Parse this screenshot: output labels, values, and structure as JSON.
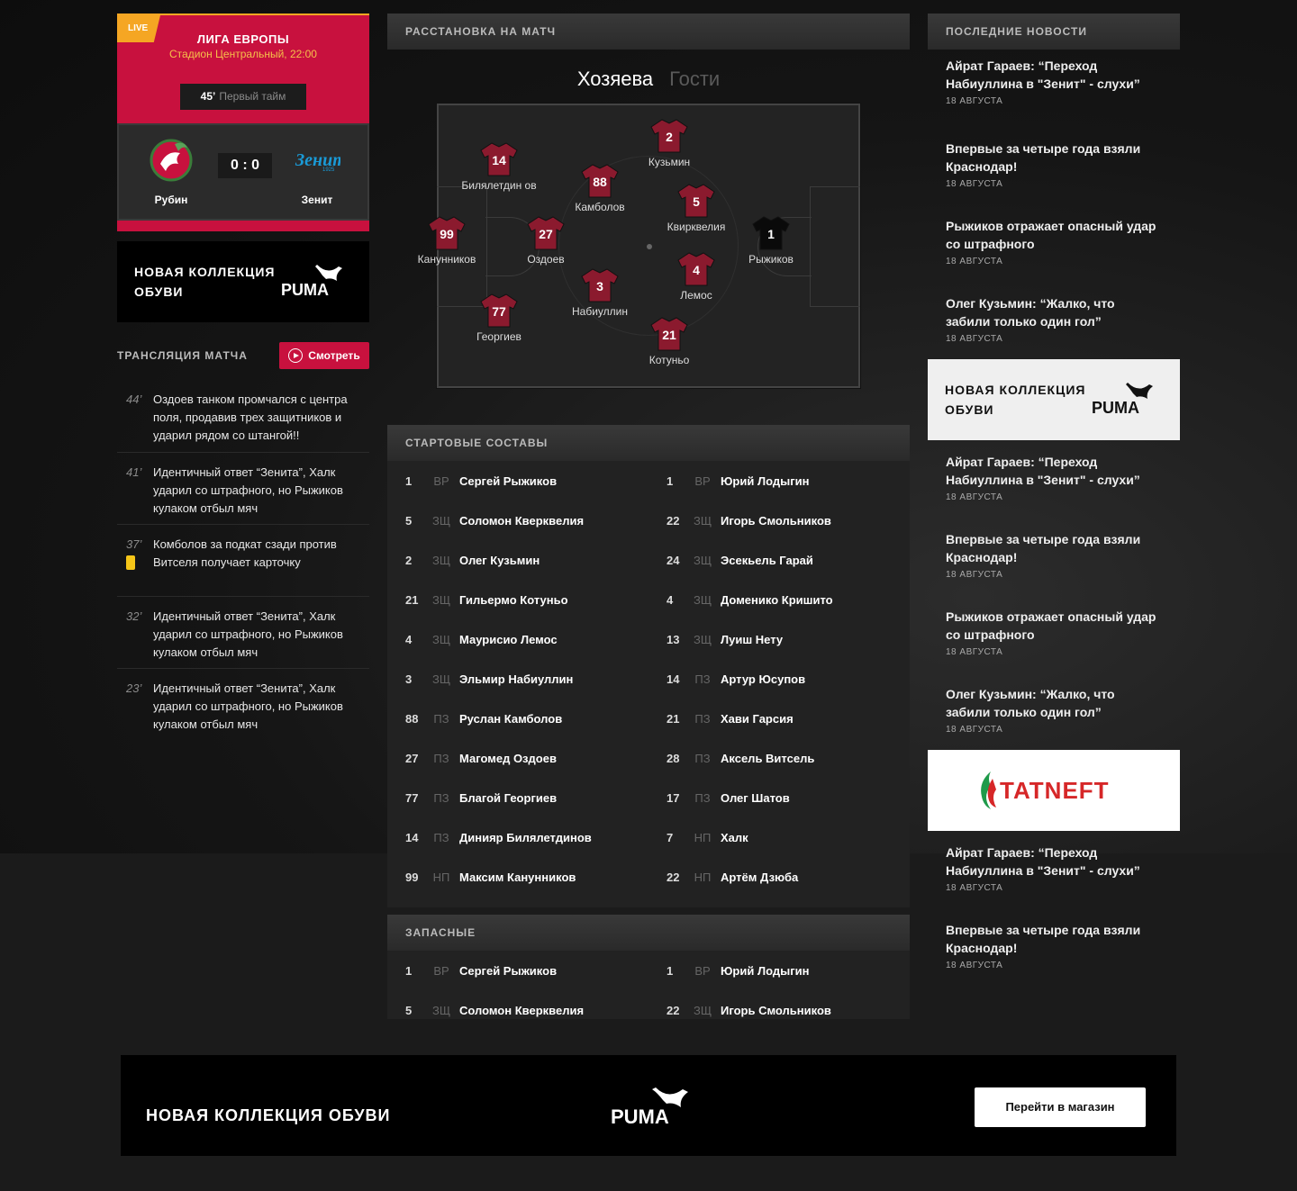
{
  "match": {
    "live_badge": "LIVE",
    "league": "ЛИГА ЕВРОПЫ",
    "stadium": "Стадион Центральный, 22:00",
    "minute": "45’",
    "period": "Первый тайм",
    "home": "Рубин",
    "away": "Зенит",
    "score": "0 : 0"
  },
  "ad": {
    "collection_line1": "НОВАЯ КОЛЛЕКЦИЯ",
    "collection_line2": "ОБУВИ",
    "collection_full": "НОВАЯ КОЛЛЕКЦИЯ ОБУВИ",
    "brand": "PUMA",
    "tatneft": "TATNEFT",
    "shop_button": "Перейти в магазин"
  },
  "broadcast": {
    "title": "ТРАНСЛЯЦИЯ МАТЧА",
    "watch": "Смотреть",
    "items": [
      {
        "minute": "44’",
        "text": "Оздоев танком промчался с центра поля, продавив трех защитников и ударил рядом со штангой!!",
        "card": false
      },
      {
        "minute": "41’",
        "text": "Идентичный ответ “Зенита”, Халк ударил со штрафного, но Рыжиков кулаком отбыл мяч",
        "card": false
      },
      {
        "minute": "37’",
        "text": "Комболов за подкат сзади против Витселя получает карточку",
        "card": true
      },
      {
        "minute": "32’",
        "text": "Идентичный ответ “Зенита”, Халк ударил со штрафного, но Рыжиков кулаком отбыл мяч",
        "card": false
      },
      {
        "minute": "23’",
        "text": "Идентичный ответ “Зенита”, Халк ударил со штрафного, но Рыжиков кулаком отбыл мяч",
        "card": false
      }
    ]
  },
  "lineup": {
    "title": "РАССТАНОВКА НА МАТЧ",
    "tab_home": "Хозяева",
    "tab_away": "Гости",
    "players": [
      {
        "num": "14",
        "name": "Билялетдин ов"
      },
      {
        "num": "88",
        "name": "Камболов"
      },
      {
        "num": "2",
        "name": "Кузьмин"
      },
      {
        "num": "5",
        "name": "Квирквелия"
      },
      {
        "num": "99",
        "name": "Канунников"
      },
      {
        "num": "27",
        "name": "Оздоев"
      },
      {
        "num": "1",
        "name": "Рыжиков"
      },
      {
        "num": "3",
        "name": "Набиуллин"
      },
      {
        "num": "4",
        "name": "Лемос"
      },
      {
        "num": "77",
        "name": "Георгиев"
      },
      {
        "num": "21",
        "name": "Котуньо"
      }
    ]
  },
  "starting": {
    "title": "СТАРТОВЫЕ СОСТАВЫ",
    "rows": [
      [
        {
          "n": "1",
          "p": "ВР",
          "name": "Сергей Рыжиков"
        },
        {
          "n": "1",
          "p": "ВР",
          "name": "Юрий Лодыгин"
        }
      ],
      [
        {
          "n": "5",
          "p": "ЗЩ",
          "name": "Соломон Кверквелия"
        },
        {
          "n": "22",
          "p": "ЗЩ",
          "name": "Игорь Смольников"
        }
      ],
      [
        {
          "n": "2",
          "p": "ЗЩ",
          "name": "Олег Кузьмин"
        },
        {
          "n": "24",
          "p": "ЗЩ",
          "name": "Эсекьель Гарай"
        }
      ],
      [
        {
          "n": "21",
          "p": "ЗЩ",
          "name": "Гильермо Котуньо"
        },
        {
          "n": "4",
          "p": "ЗЩ",
          "name": "Доменико Кришито"
        }
      ],
      [
        {
          "n": "4",
          "p": "ЗЩ",
          "name": "Маурисио Лемос"
        },
        {
          "n": "13",
          "p": "ЗЩ",
          "name": "Луиш Нету"
        }
      ],
      [
        {
          "n": "3",
          "p": "ЗЩ",
          "name": "Эльмир Набиуллин"
        },
        {
          "n": "14",
          "p": "ПЗ",
          "name": "Артур Юсупов"
        }
      ],
      [
        {
          "n": "88",
          "p": "ПЗ",
          "name": "Руслан Камболов"
        },
        {
          "n": "21",
          "p": "ПЗ",
          "name": "Хави Гарсия"
        }
      ],
      [
        {
          "n": "27",
          "p": "ПЗ",
          "name": "Магомед Оздоев"
        },
        {
          "n": "28",
          "p": "ПЗ",
          "name": "Аксель Витсель"
        }
      ],
      [
        {
          "n": "77",
          "p": "ПЗ",
          "name": "Благой Георгиев"
        },
        {
          "n": "17",
          "p": "ПЗ",
          "name": "Олег Шатов"
        }
      ],
      [
        {
          "n": "14",
          "p": "ПЗ",
          "name": "Динияр Билялетдинов"
        },
        {
          "n": "7",
          "p": "НП",
          "name": "Халк"
        }
      ],
      [
        {
          "n": "99",
          "p": "НП",
          "name": "Максим Канунников"
        },
        {
          "n": "22",
          "p": "НП",
          "name": "Артём Дзюба"
        }
      ]
    ]
  },
  "subs": {
    "title": "ЗАПАСНЫЕ",
    "rows": [
      [
        {
          "n": "1",
          "p": "ВР",
          "name": "Сергей Рыжиков"
        },
        {
          "n": "1",
          "p": "ВР",
          "name": "Юрий Лодыгин"
        }
      ],
      [
        {
          "n": "5",
          "p": "ЗЩ",
          "name": "Соломон Кверквелия"
        },
        {
          "n": "22",
          "p": "ЗЩ",
          "name": "Игорь Смольников"
        }
      ]
    ]
  },
  "news": {
    "title": "ПОСЛЕДНИЕ НОВОСТИ",
    "items": [
      {
        "title": "Айрат Гараев: “Переход Набиуллина в \"Зенит\" - слухи”",
        "date": "18 АВГУСТА"
      },
      {
        "title": "Впервые за четыре года взяли Краснодар!",
        "date": "18 АВГУСТА"
      },
      {
        "title": "Рыжиков отражает опасный удар со штрафного",
        "date": "18 АВГУСТА"
      },
      {
        "title": "Олег Кузьмин: “Жалко, что забили только один гол”",
        "date": "18 АВГУСТА"
      }
    ]
  },
  "colors": {
    "accent": "#c8113e",
    "live": "#f5a623",
    "card": "#f5c518",
    "shirt": "#8b1a2e"
  }
}
